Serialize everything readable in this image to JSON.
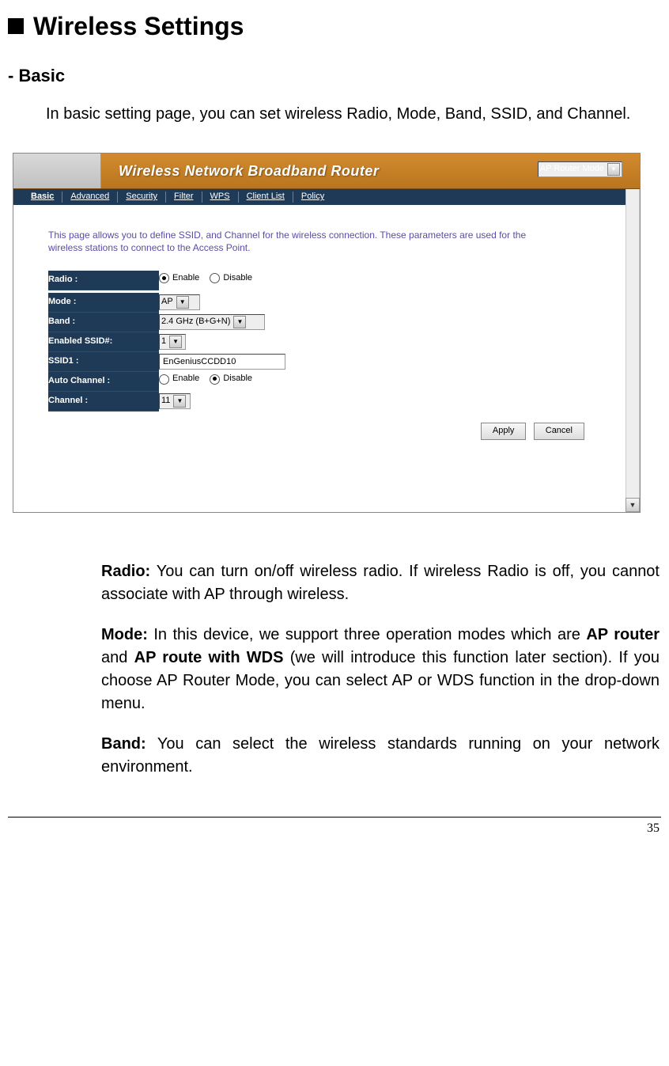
{
  "page": {
    "heading": "Wireless Settings",
    "subheading": "- Basic",
    "intro": "In basic setting page, you can set wireless Radio, Mode, Band, SSID, and Channel.",
    "page_number": "35"
  },
  "screenshot": {
    "title": "Wireless Network Broadband Router",
    "mode_dropdown": "AP Router Mode",
    "tabs": [
      "Basic",
      "Advanced",
      "Security",
      "Filter",
      "WPS",
      "Client List",
      "Policy"
    ],
    "active_tab": "Basic",
    "description": "This page allows you to define SSID, and Channel for the wireless connection. These parameters are used for the wireless stations to connect to the Access Point.",
    "fields": {
      "radio_label": "Radio :",
      "radio_enable": "Enable",
      "radio_disable": "Disable",
      "mode_label": "Mode :",
      "mode_value": "AP",
      "band_label": "Band :",
      "band_value": "2.4 GHz (B+G+N)",
      "enabled_ssid_label": "Enabled SSID#:",
      "enabled_ssid_value": "1",
      "ssid1_label": "SSID1 :",
      "ssid1_value": "EnGeniusCCDD10",
      "auto_channel_label": "Auto Channel :",
      "auto_enable": "Enable",
      "auto_disable": "Disable",
      "channel_label": "Channel :",
      "channel_value": "11"
    },
    "buttons": {
      "apply": "Apply",
      "cancel": "Cancel"
    }
  },
  "descriptions": {
    "radio_term": "Radio:",
    "radio_text_1": " You can turn on/off wireless radio. If wireless Radio is off, you cannot",
    "radio_text_2": "associate with AP through wireless.",
    "mode_term": "Mode:",
    "mode_text_1": " In this device, we support three operation modes which are ",
    "mode_bold_1": "AP router",
    "mode_text_2": "and ",
    "mode_bold_2": "AP route with WDS",
    "mode_text_3": " (we will introduce this function later section). If you choose AP Router Mode, you can select AP or WDS function in the drop-down menu.",
    "band_term": "Band:",
    "band_text": " You can select the wireless standards running on your network environment."
  }
}
